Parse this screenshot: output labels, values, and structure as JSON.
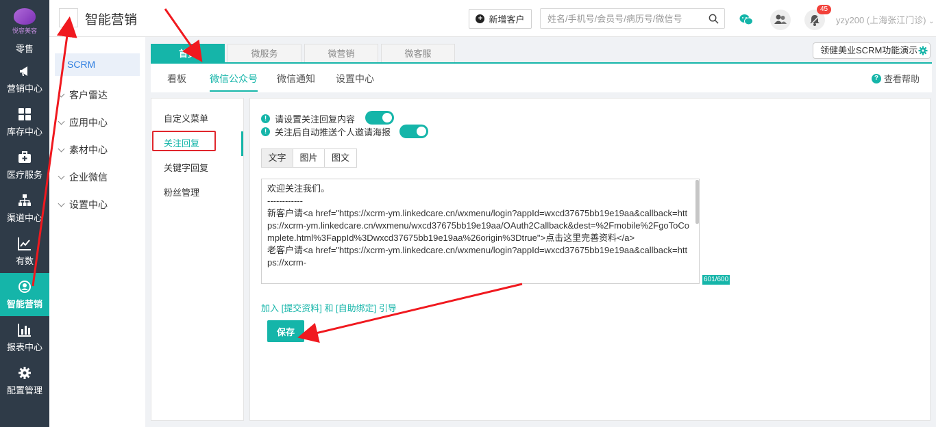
{
  "brand": {
    "logo_text": "悦容美容"
  },
  "leftnav": [
    {
      "label": "零售",
      "icon": "retail-icon"
    },
    {
      "label": "营销中心",
      "icon": "megaphone-icon"
    },
    {
      "label": "库存中心",
      "icon": "grid-icon"
    },
    {
      "label": "医疗服务",
      "icon": "medical-kit-icon"
    },
    {
      "label": "渠道中心",
      "icon": "org-chart-icon"
    },
    {
      "label": "有数",
      "icon": "trend-chart-icon"
    },
    {
      "label": "智能营销",
      "icon": "smart-marketing-icon",
      "active": true
    },
    {
      "label": "报表中心",
      "icon": "bar-chart-icon"
    },
    {
      "label": "配置管理",
      "icon": "gear-icon"
    }
  ],
  "header": {
    "title": "智能营销",
    "new_customer": "新增客户",
    "search_placeholder": "姓名/手机号/会员号/病历号/微信号",
    "notification_count": "45",
    "user": "yzy200 (上海张江门诊)"
  },
  "sidebar": {
    "items": [
      "SCRM",
      "客户雷达",
      "应用中心",
      "素材中心",
      "企业微信",
      "设置中心"
    ]
  },
  "tabs": [
    "首页",
    "微服务",
    "微营销",
    "微客服"
  ],
  "demo_label": "领健美业SCRM功能演示",
  "subtabs": [
    "看板",
    "微信公众号",
    "微信通知",
    "设置中心"
  ],
  "help": "查看帮助",
  "menu": [
    "自定义菜单",
    "关注回复",
    "关键字回复",
    "粉丝管理"
  ],
  "content": {
    "opt1": "请设置关注回复内容",
    "opt2": "关注后自动推送个人邀请海报",
    "seg": [
      "文字",
      "图片",
      "图文"
    ],
    "text": "欢迎关注我们。\n------------\n新客户请<a href=\"https://xcrm-ym.linkedcare.cn/wxmenu/login?appId=wxcd37675bb19e19aa&callback=https://xcrm-ym.linkedcare.cn/wxmenu/wxcd37675bb19e19aa/OAuth2Callback&dest=%2Fmobile%2FgoToComplete.html%3FappId%3Dwxcd37675bb19e19aa%26origin%3Dtrue\">点击这里完善资料</a>\n老客户请<a href=\"https://xcrm-ym.linkedcare.cn/wxmenu/login?appId=wxcd37675bb19e19aa&callback=https://xcrm-",
    "counter": "601/600",
    "join_link": "加入 [提交资料] 和 [自助绑定] 引导",
    "save": "保存"
  },
  "colors": {
    "accent": "#15b5a9",
    "nav_bg": "#2f3b48",
    "highlight": "#e0262c"
  }
}
